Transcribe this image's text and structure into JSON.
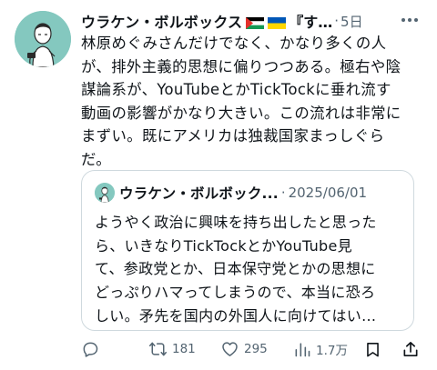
{
  "post": {
    "author_name": "ウラケン・ボルボックス",
    "author_name_tail": "『す…",
    "separator": "·",
    "time": "5日",
    "text": "林原めぐみさんだけでなく、かなり多くの人が、排外主義的思想に偏りつつある。極右や陰謀論系が、YouTubeとかTickTockに垂れ流す動画の影響がかなり大きい。この流れは非常にまずい。既にアメリカは独裁国家まっしぐらだ。",
    "text_lines": [
      "林原めぐみさんだけでなく、かなり多くの人",
      "が、排外主義的思想に偏りつつある。極右や陰",
      "謀論系が、YouTubeとかTickTockに垂れ流す",
      "動画の影響がかなり大きい。この流れは非常に",
      "まずい。既にアメリカは独裁国家まっしぐら",
      "だ。"
    ],
    "icons": {
      "avatar": "illustrated-avatar",
      "flag_1": "palestine-flag",
      "flag_2": "ukraine-flag",
      "more": "more-options-icon"
    }
  },
  "quote": {
    "author_name": "ウラケン・ボルボック...",
    "separator": "·",
    "date": "2025/06/01",
    "text_lines": [
      "ようやく政治に興味を持ち出したと思った",
      "ら、いきなりTickTockとかYouTube見",
      "て、参政党とか、日本保守党とかの思想に",
      "どっぷりハマってしまうので、本当に恐ろ",
      "しい。矛先を国内の外国人に向けてはい..."
    ]
  },
  "actions": {
    "reply_count": "",
    "repost_count": "181",
    "like_count": "295",
    "view_count": "1.7万",
    "icons": [
      "reply-icon",
      "repost-icon",
      "like-icon",
      "views-icon",
      "bookmark-icon",
      "share-icon"
    ]
  },
  "colors": {
    "text": "#0f1419",
    "secondary": "#536471",
    "border": "#cfd9de",
    "avatar_bg": "#84c8bf"
  }
}
